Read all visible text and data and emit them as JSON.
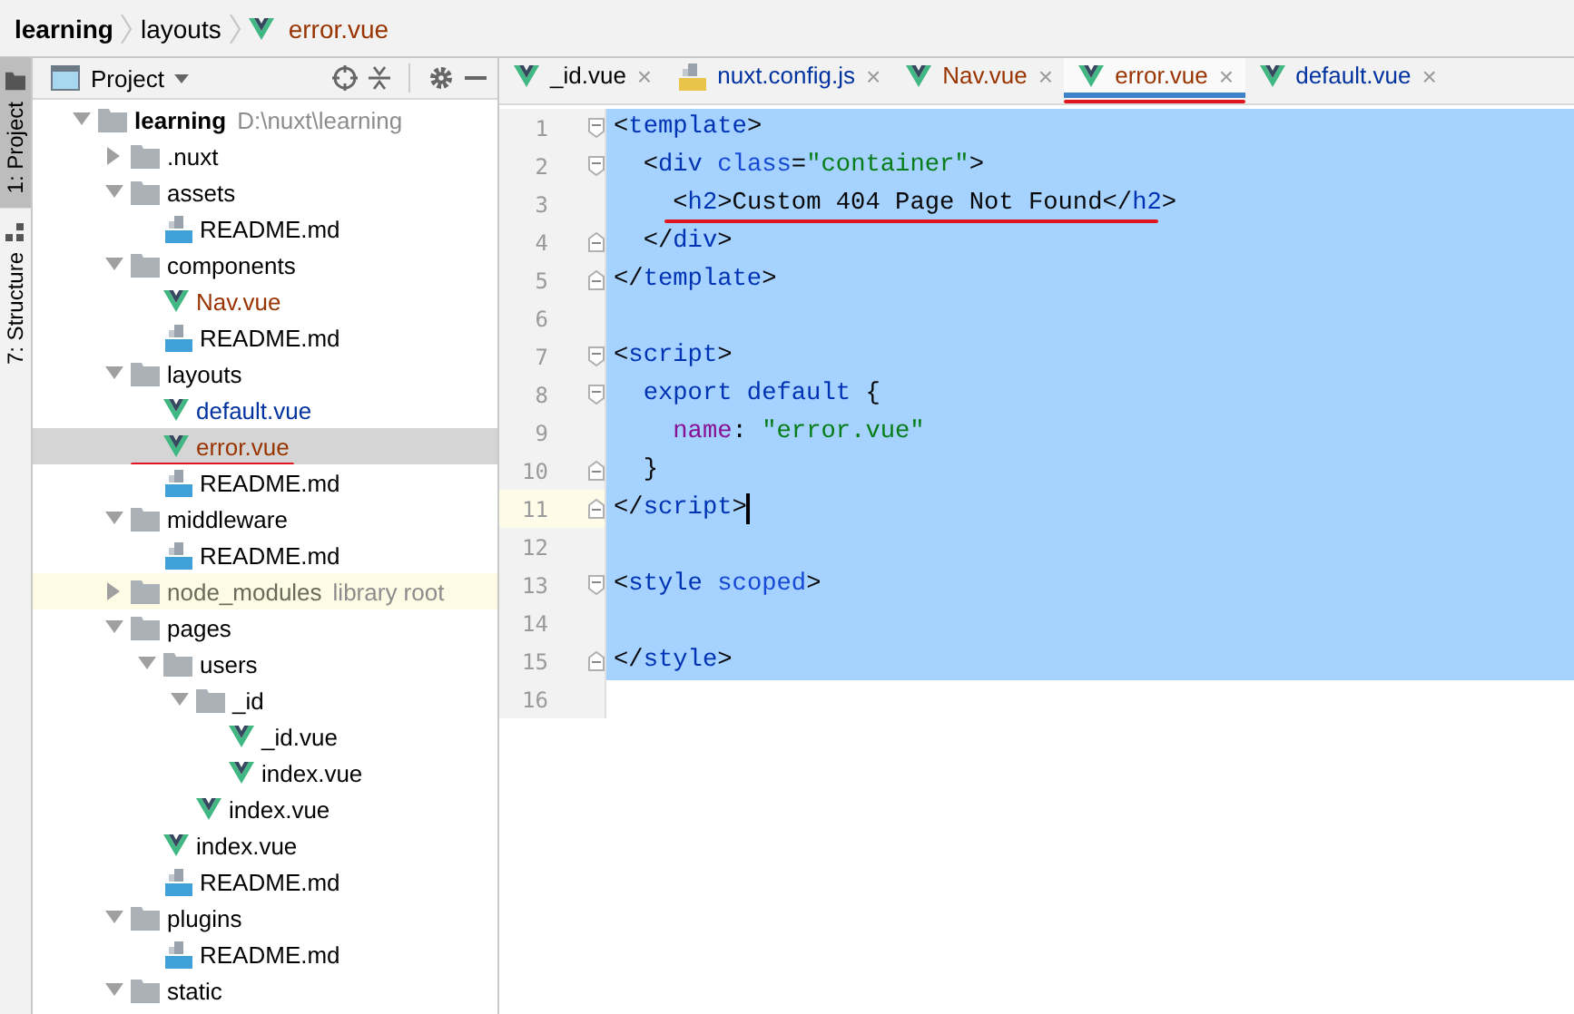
{
  "breadcrumb": [
    {
      "label": "learning",
      "kind": "project",
      "color": "#000000"
    },
    {
      "label": "layouts",
      "kind": "folder",
      "color": "#000000"
    },
    {
      "label": "error.vue",
      "kind": "vue",
      "color": "#993300"
    }
  ],
  "tool_strip": [
    {
      "label": "1: Project",
      "kind": "project",
      "selected": true
    },
    {
      "label": "7: Structure",
      "kind": "structure",
      "selected": false
    }
  ],
  "project_panel": {
    "title": "Project",
    "tree": [
      {
        "name": "learning",
        "hint": "D:\\nuxt\\learning",
        "kind": "root",
        "expanded": true,
        "selected": false,
        "color": "#000000",
        "annotated": false,
        "children": [
          {
            "name": ".nuxt",
            "kind": "folder",
            "expanded": false,
            "selected": false,
            "color": "#000000",
            "annotated": false
          },
          {
            "name": "assets",
            "kind": "folder",
            "expanded": true,
            "selected": false,
            "color": "#000000",
            "annotated": false,
            "children": [
              {
                "name": "README.md",
                "kind": "md",
                "selected": false,
                "color": "#000000",
                "annotated": false
              }
            ]
          },
          {
            "name": "components",
            "kind": "folder",
            "expanded": true,
            "selected": false,
            "color": "#000000",
            "annotated": false,
            "children": [
              {
                "name": "Nav.vue",
                "kind": "vue",
                "selected": false,
                "color": "#993300",
                "annotated": false
              },
              {
                "name": "README.md",
                "kind": "md",
                "selected": false,
                "color": "#000000",
                "annotated": false
              }
            ]
          },
          {
            "name": "layouts",
            "kind": "folder",
            "expanded": true,
            "selected": false,
            "color": "#000000",
            "annotated": false,
            "children": [
              {
                "name": "default.vue",
                "kind": "vue",
                "selected": false,
                "color": "#0032a0",
                "annotated": false
              },
              {
                "name": "error.vue",
                "kind": "vue",
                "selected": true,
                "color": "#993300",
                "annotated": true
              },
              {
                "name": "README.md",
                "kind": "md",
                "selected": false,
                "color": "#000000",
                "annotated": false
              }
            ]
          },
          {
            "name": "middleware",
            "kind": "folder",
            "expanded": true,
            "selected": false,
            "color": "#000000",
            "annotated": false,
            "children": [
              {
                "name": "README.md",
                "kind": "md",
                "selected": false,
                "color": "#000000",
                "annotated": false
              }
            ]
          },
          {
            "name": "node_modules",
            "hint": "library root",
            "kind": "library",
            "expanded": false,
            "selected": false,
            "color": "#6a6a5a",
            "annotated": false
          },
          {
            "name": "pages",
            "kind": "folder",
            "expanded": true,
            "selected": false,
            "color": "#000000",
            "annotated": false,
            "children": [
              {
                "name": "users",
                "kind": "folder",
                "expanded": true,
                "selected": false,
                "color": "#000000",
                "annotated": false,
                "children": [
                  {
                    "name": "_id",
                    "kind": "folder",
                    "expanded": true,
                    "selected": false,
                    "color": "#000000",
                    "annotated": false,
                    "children": [
                      {
                        "name": "_id.vue",
                        "kind": "vue",
                        "selected": false,
                        "color": "#000000",
                        "annotated": false
                      },
                      {
                        "name": "index.vue",
                        "kind": "vue",
                        "selected": false,
                        "color": "#000000",
                        "annotated": false
                      }
                    ]
                  },
                  {
                    "name": "index.vue",
                    "kind": "vue",
                    "selected": false,
                    "color": "#000000",
                    "annotated": false
                  }
                ]
              },
              {
                "name": "index.vue",
                "kind": "vue",
                "selected": false,
                "color": "#000000",
                "annotated": false
              },
              {
                "name": "README.md",
                "kind": "md",
                "selected": false,
                "color": "#000000",
                "annotated": false
              }
            ]
          },
          {
            "name": "plugins",
            "kind": "folder",
            "expanded": true,
            "selected": false,
            "color": "#000000",
            "annotated": false,
            "children": [
              {
                "name": "README.md",
                "kind": "md",
                "selected": false,
                "color": "#000000",
                "annotated": false
              }
            ]
          },
          {
            "name": "static",
            "kind": "folder",
            "expanded": true,
            "selected": false,
            "color": "#000000",
            "annotated": false
          }
        ]
      }
    ]
  },
  "editor": {
    "tabs": [
      {
        "label": "_id.vue",
        "kind": "vue",
        "color": "#000000",
        "close": "×",
        "selected": false,
        "annotated": false
      },
      {
        "label": "nuxt.config.js",
        "kind": "js",
        "color": "#0032a0",
        "close": "×",
        "selected": false,
        "annotated": false
      },
      {
        "label": "Nav.vue",
        "kind": "vue",
        "color": "#993300",
        "close": "×",
        "selected": false,
        "annotated": false
      },
      {
        "label": "error.vue",
        "kind": "vue",
        "color": "#993300",
        "close": "×",
        "selected": true,
        "annotated": true
      },
      {
        "label": "default.vue",
        "kind": "vue",
        "color": "#0032a0",
        "close": "×",
        "selected": false,
        "annotated": false
      }
    ],
    "lines": [
      {
        "number": "1",
        "kind": "opener",
        "selected": true,
        "current": false,
        "annotated": false,
        "tokens": [
          {
            "kind": "punct",
            "t": "<"
          },
          {
            "kind": "tag",
            "t": "template"
          },
          {
            "kind": "punct",
            "t": ">"
          }
        ]
      },
      {
        "number": "2",
        "kind": "opener",
        "selected": true,
        "current": false,
        "annotated": false,
        "tokens": [
          {
            "kind": "punct",
            "t": "  <"
          },
          {
            "kind": "tag",
            "t": "div"
          },
          {
            "kind": "attr",
            "t": " class"
          },
          {
            "kind": "punct",
            "t": "="
          },
          {
            "kind": "str",
            "t": "\"container\""
          },
          {
            "kind": "punct",
            "t": ">"
          }
        ]
      },
      {
        "number": "3",
        "kind": "plain",
        "selected": true,
        "current": false,
        "annotated": true,
        "tokens": [
          {
            "kind": "punct",
            "t": "    <"
          },
          {
            "kind": "tag",
            "t": "h2"
          },
          {
            "kind": "punct",
            "t": ">"
          },
          {
            "kind": "text",
            "t": "Custom 404 Page Not Found"
          },
          {
            "kind": "punct",
            "t": "</"
          },
          {
            "kind": "tag",
            "t": "h2"
          },
          {
            "kind": "punct",
            "t": ">"
          }
        ]
      },
      {
        "number": "4",
        "kind": "closer",
        "selected": true,
        "current": false,
        "annotated": false,
        "tokens": [
          {
            "kind": "punct",
            "t": "  </"
          },
          {
            "kind": "tag",
            "t": "div"
          },
          {
            "kind": "punct",
            "t": ">"
          }
        ]
      },
      {
        "number": "5",
        "kind": "closer",
        "selected": true,
        "current": false,
        "annotated": false,
        "tokens": [
          {
            "kind": "punct",
            "t": "</"
          },
          {
            "kind": "tag",
            "t": "template"
          },
          {
            "kind": "punct",
            "t": ">"
          }
        ]
      },
      {
        "number": "6",
        "kind": "plain",
        "selected": true,
        "current": false,
        "annotated": false
      },
      {
        "number": "7",
        "kind": "opener",
        "selected": true,
        "current": false,
        "annotated": false,
        "tokens": [
          {
            "kind": "punct",
            "t": "<"
          },
          {
            "kind": "tag",
            "t": "script"
          },
          {
            "kind": "punct",
            "t": ">"
          }
        ]
      },
      {
        "number": "8",
        "kind": "opener",
        "selected": true,
        "current": false,
        "annotated": false,
        "tokens": [
          {
            "kind": "kw",
            "t": "  export default"
          },
          {
            "kind": "text",
            "t": " {"
          }
        ]
      },
      {
        "number": "9",
        "kind": "plain",
        "selected": true,
        "current": false,
        "annotated": false,
        "tokens": [
          {
            "kind": "prop",
            "t": "    name"
          },
          {
            "kind": "text",
            "t": ": "
          },
          {
            "kind": "str",
            "t": "\"error.vue\""
          }
        ]
      },
      {
        "number": "10",
        "kind": "closer",
        "selected": true,
        "current": false,
        "annotated": false,
        "tokens": [
          {
            "kind": "text",
            "t": "  }"
          }
        ]
      },
      {
        "number": "11",
        "kind": "closer",
        "selected": true,
        "current": true,
        "annotated": false,
        "tokens": [
          {
            "kind": "punct",
            "t": "</"
          },
          {
            "kind": "tag",
            "t": "script"
          },
          {
            "kind": "punct",
            "t": ">"
          }
        ]
      },
      {
        "number": "12",
        "kind": "plain",
        "selected": true,
        "current": false,
        "annotated": false
      },
      {
        "number": "13",
        "kind": "opener",
        "selected": true,
        "current": false,
        "annotated": false,
        "tokens": [
          {
            "kind": "punct",
            "t": "<"
          },
          {
            "kind": "tag",
            "t": "style"
          },
          {
            "kind": "attr",
            "t": " scoped"
          },
          {
            "kind": "punct",
            "t": ">"
          }
        ]
      },
      {
        "number": "14",
        "kind": "plain",
        "selected": true,
        "current": false,
        "annotated": false
      },
      {
        "number": "15",
        "kind": "closer",
        "selected": true,
        "current": false,
        "annotated": false,
        "tokens": [
          {
            "kind": "punct",
            "t": "</"
          },
          {
            "kind": "tag",
            "t": "style"
          },
          {
            "kind": "punct",
            "t": ">"
          }
        ]
      },
      {
        "number": "16",
        "kind": "plain",
        "selected": false,
        "current": false,
        "annotated": false
      }
    ]
  }
}
